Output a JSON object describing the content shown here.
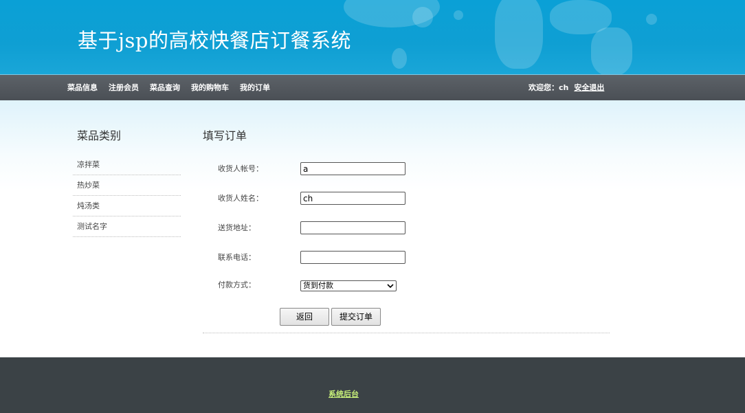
{
  "header": {
    "title": "基于jsp的高校快餐店订餐系统"
  },
  "nav": {
    "items": [
      {
        "label": "菜品信息"
      },
      {
        "label": "注册会员"
      },
      {
        "label": "菜品查询"
      },
      {
        "label": "我的购物车"
      },
      {
        "label": "我的订单"
      }
    ],
    "welcome": "欢迎您：ch",
    "logout": "安全退出"
  },
  "sidebar": {
    "title": "菜品类别",
    "categories": [
      {
        "label": "凉拌菜"
      },
      {
        "label": "热炒菜"
      },
      {
        "label": "炖汤类"
      },
      {
        "label": "测试名字"
      }
    ]
  },
  "form": {
    "title": "填写订单",
    "fields": {
      "account": {
        "label": "收货人帐号：",
        "value": "a"
      },
      "name": {
        "label": "收货人姓名：",
        "value": "ch"
      },
      "address": {
        "label": "送货地址：",
        "value": ""
      },
      "phone": {
        "label": "联系电话：",
        "value": ""
      },
      "payment": {
        "label": "付款方式：",
        "selected": "货到付款"
      }
    },
    "back_button": "返回",
    "submit_button": "提交订单"
  },
  "footer": {
    "link": "系统后台"
  },
  "colors": {
    "banner": "#0f9fd3",
    "navbar": "#4a4f55",
    "footer": "#3b4246",
    "footer_link": "#c8f07a"
  }
}
